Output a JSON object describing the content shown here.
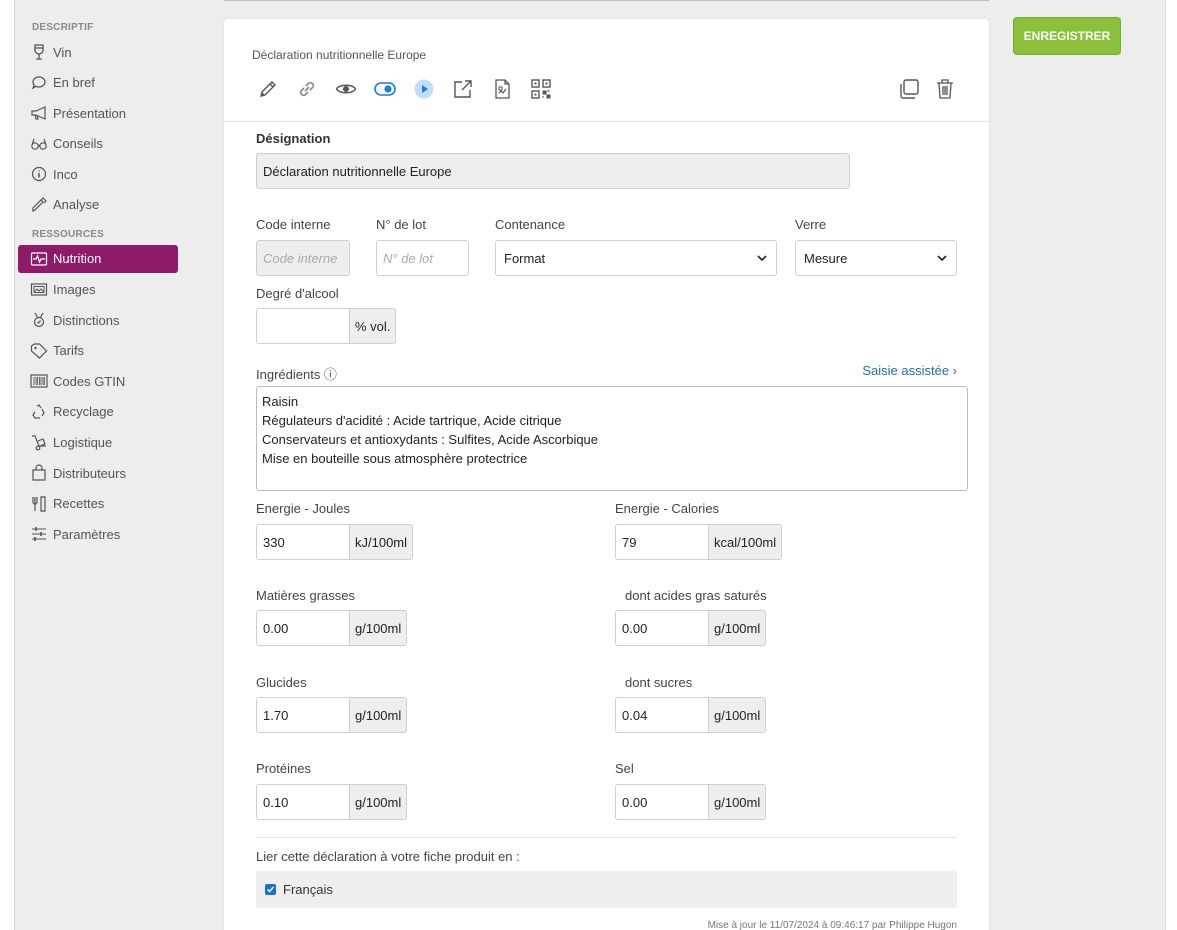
{
  "sidebar": {
    "section1": "DESCRIPTIF",
    "items1": [
      {
        "label": "Vin",
        "icon": "glass-icon"
      },
      {
        "label": "En bref",
        "icon": "speech-bubble-icon"
      },
      {
        "label": "Présentation",
        "icon": "megaphone-icon"
      },
      {
        "label": "Conseils",
        "icon": "glasses-icon"
      },
      {
        "label": "Inco",
        "icon": "info-icon"
      },
      {
        "label": "Analyse",
        "icon": "pipette-icon"
      }
    ],
    "section2": "RESSOURCES",
    "items2": [
      {
        "label": "Nutrition",
        "icon": "pulse-icon",
        "active": true
      },
      {
        "label": "Images",
        "icon": "images-icon"
      },
      {
        "label": "Distinctions",
        "icon": "medal-icon"
      },
      {
        "label": "Tarifs",
        "icon": "tag-icon"
      },
      {
        "label": "Codes GTIN",
        "icon": "barcode-icon"
      },
      {
        "label": "Recyclage",
        "icon": "recycle-icon"
      },
      {
        "label": "Logistique",
        "icon": "hand-truck-icon"
      },
      {
        "label": "Distributeurs",
        "icon": "shopping-bag-icon"
      },
      {
        "label": "Recettes",
        "icon": "cutlery-icon"
      },
      {
        "label": "Paramètres",
        "icon": "sliders-icon"
      }
    ]
  },
  "card": {
    "subtitle": "Déclaration nutritionnelle Europe",
    "designation_label": "Désignation",
    "designation_value": "Déclaration nutritionnelle Europe",
    "code_label": "Code interne",
    "code_placeholder": "Code interne",
    "lot_label": "N° de lot",
    "lot_placeholder": "N° de lot",
    "contenance_label": "Contenance",
    "contenance_value": "Format",
    "verre_label": "Verre",
    "verre_value": "Mesure",
    "alcool_label": "Degré d'alcool",
    "alcool_value": "",
    "alcool_unit": "% vol.",
    "ingredients_label": "Ingrédients ⓘ",
    "saisie_link": "Saisie assistée ›",
    "ingredients": [
      "Raisin",
      "Régulateurs d'acidité : Acide tartrique, Acide citrique",
      "Conservateurs et antioxydants : Sulfites, Acide Ascorbique",
      "Mise en bouteille sous atmosphère protectrice"
    ],
    "nutrients": {
      "energie_j": {
        "label": "Energie - Joules",
        "value": "330",
        "unit": "kJ/100ml"
      },
      "energie_c": {
        "label": "Energie - Calories",
        "value": "79",
        "unit": "kcal/100ml"
      },
      "mg": {
        "label": "Matières grasses",
        "value": "0.00",
        "unit": "g/100ml"
      },
      "ags": {
        "label": "dont acides gras saturés",
        "value": "0.00",
        "unit": "g/100ml"
      },
      "glucides": {
        "label": "Glucides",
        "value": "1.70",
        "unit": "g/100ml"
      },
      "sucres": {
        "label": "dont sucres",
        "value": "0.04",
        "unit": "g/100ml"
      },
      "proteines": {
        "label": "Protéines",
        "value": "0.10",
        "unit": "g/100ml"
      },
      "sel": {
        "label": "Sel",
        "value": "0.00",
        "unit": "g/100ml"
      }
    },
    "link_label": "Lier cette déclaration à votre fiche produit en :",
    "language": "Français",
    "updated": "Mise à jour le 11/07/2024 à 09:46:17 par Philippe Hugon"
  },
  "save_label": "ENREGISTRER",
  "colors": {
    "accent": "#8e1b6a",
    "save": "#8cbf3a",
    "link": "#1a73a8",
    "toggle": "#1a7de0"
  }
}
